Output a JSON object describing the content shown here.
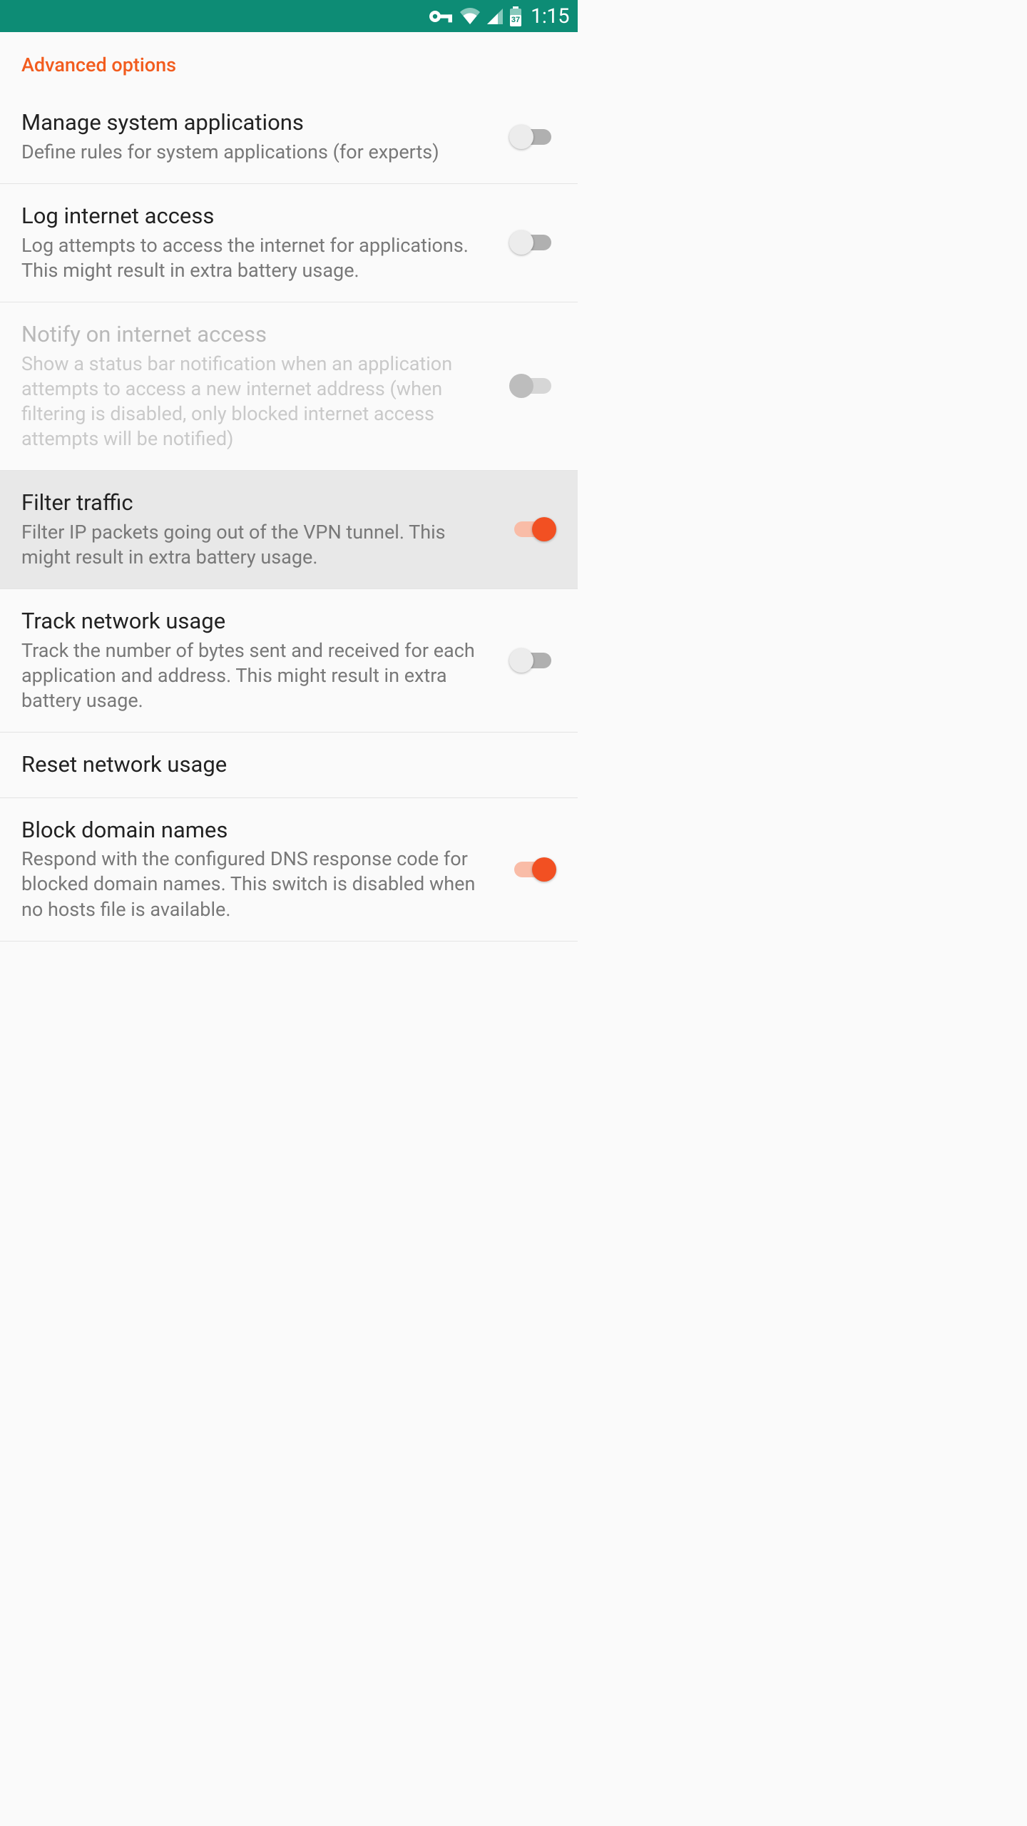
{
  "status": {
    "time": "1:15",
    "battery_text": "37"
  },
  "section": {
    "title": "Advanced options"
  },
  "rows": [
    {
      "title": "Manage system applications",
      "subtitle": "Define rules for system applications (for experts)"
    },
    {
      "title": "Log internet access",
      "subtitle": "Log attempts to access the internet for applications. This might result in extra battery usage."
    },
    {
      "title": "Notify on internet access",
      "subtitle": "Show a status bar notification when an application attempts to access a new internet address (when filtering is disabled, only blocked internet access attempts will be notified)"
    },
    {
      "title": "Filter traffic",
      "subtitle": "Filter IP packets going out of the VPN tunnel. This might result in extra battery usage."
    },
    {
      "title": "Track network usage",
      "subtitle": "Track the number of bytes sent and received for each application and address. This might result in extra battery usage."
    },
    {
      "title": "Reset network usage"
    },
    {
      "title": "Block domain names",
      "subtitle": "Respond with the configured DNS response code for blocked domain names. This switch is disabled when no hosts file is available."
    }
  ]
}
